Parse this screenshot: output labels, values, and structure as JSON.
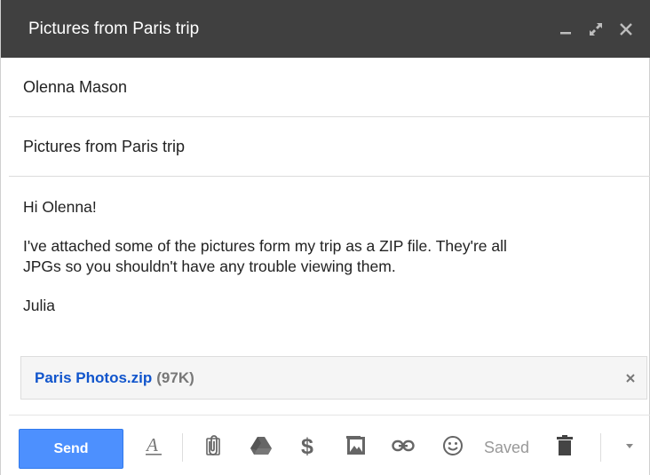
{
  "window": {
    "title": "Pictures from Paris trip"
  },
  "compose": {
    "to": "Olenna Mason",
    "subject": "Pictures from Paris trip",
    "body": {
      "greeting": "Hi Olenna!",
      "line1": "I've attached some of the pictures form my trip as a ZIP file. They're all",
      "line2": "JPGs so you shouldn't have any trouble viewing them.",
      "signature": "Julia"
    },
    "attachment": {
      "name": "Paris Photos.zip",
      "size": "(97K)"
    }
  },
  "toolbar": {
    "send_label": "Send",
    "saved_label": "Saved",
    "icons": [
      "format-text-icon",
      "paperclip-icon",
      "drive-icon",
      "dollar-icon",
      "photo-icon",
      "link-icon",
      "emoji-icon",
      "trash-icon",
      "more-options-icon"
    ]
  },
  "colors": {
    "titlebar": "#404040",
    "send_button": "#4d90fe",
    "link": "#1155cc"
  }
}
